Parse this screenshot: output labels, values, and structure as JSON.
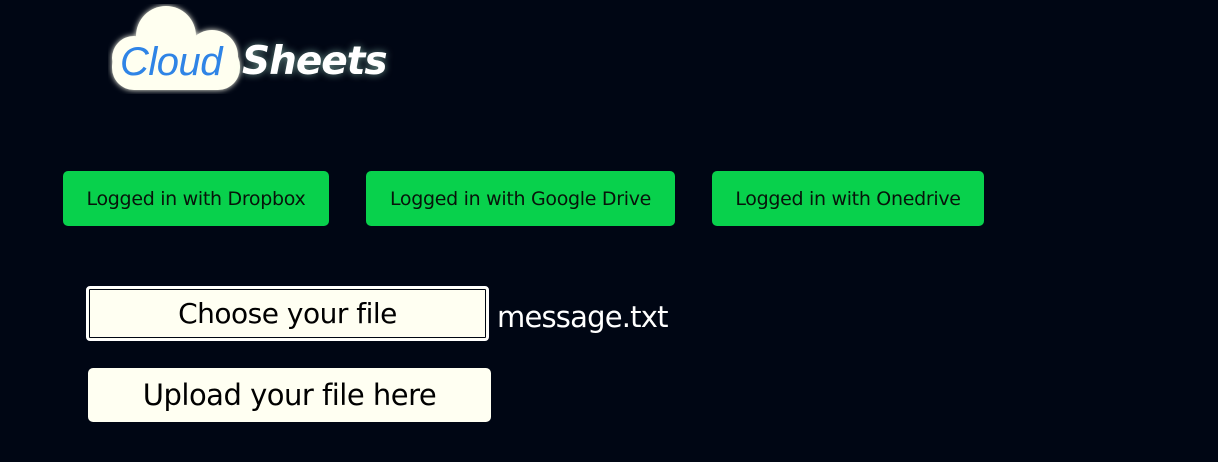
{
  "logo": {
    "cloud_word": "Cloud",
    "sheets_word": "Sheets",
    "icon": "cloud-icon"
  },
  "logins": {
    "dropbox": "Logged in with Dropbox",
    "google_drive": "Logged in with Google Drive",
    "onedrive": "Logged in with Onedrive"
  },
  "file": {
    "choose_label": "Choose your file",
    "selected_name": "message.txt",
    "upload_label": "Upload your file here"
  },
  "colors": {
    "background": "#000614",
    "login_green": "#08d14c",
    "cloud_blue": "#2f84e6",
    "button_cream": "#fffff2"
  }
}
